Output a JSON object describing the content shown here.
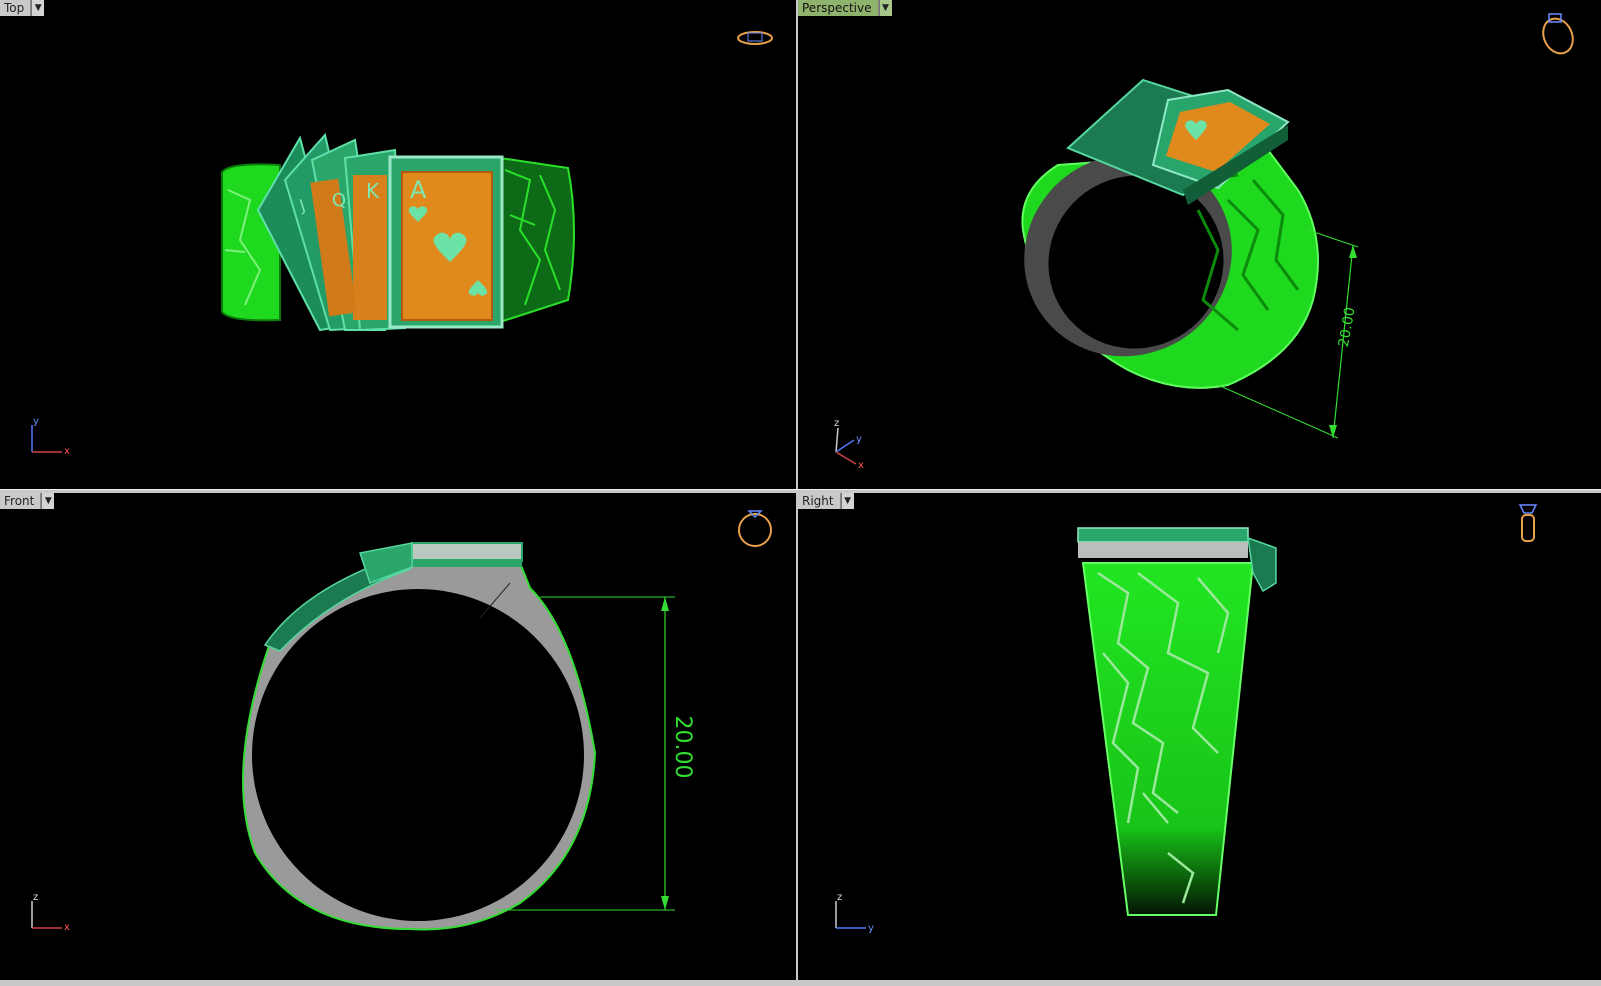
{
  "viewports": {
    "top": {
      "label": "Top",
      "axis_a": "y",
      "axis_b": "x"
    },
    "perspective": {
      "label": "Perspective",
      "axis_a": "z",
      "axis_b": "y",
      "axis_c": "x",
      "dimension": "20.00"
    },
    "front": {
      "label": "Front",
      "axis_a": "z",
      "axis_b": "x",
      "dimension": "20.00"
    },
    "right": {
      "label": "Right",
      "axis_a": "z",
      "axis_b": "y"
    }
  },
  "cards": [
    "J",
    "Q",
    "K",
    "A"
  ],
  "colors": {
    "ring_green": "#22e622",
    "card_green": "#2aa66a",
    "gold": "#e08a1e",
    "silver": "#9a9a9a",
    "dim_green": "#33dd33"
  },
  "dropdown_icon": "triangle-down-icon"
}
